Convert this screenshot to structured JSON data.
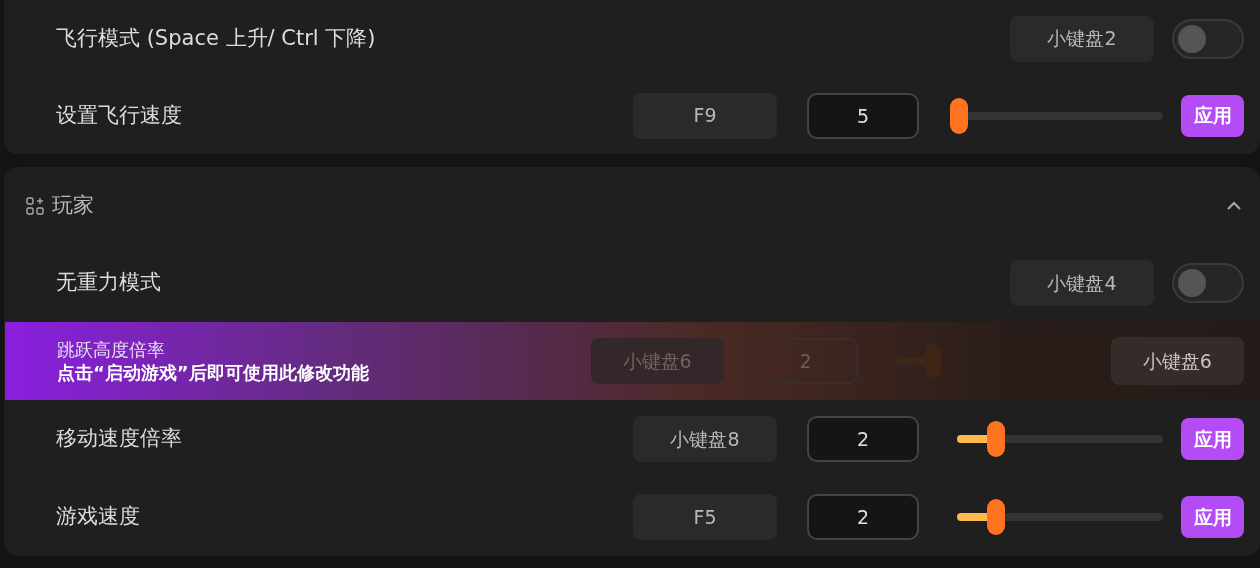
{
  "sections": [
    {
      "rows": [
        {
          "kind": "toggle",
          "label": "飞行模式 (Space 上升/ Ctrl 下降)",
          "hotkey": "小键盘2",
          "on": false
        },
        {
          "kind": "slider",
          "label": "设置飞行速度",
          "hotkey": "F9",
          "value": "5",
          "level": 0,
          "button": "应用"
        }
      ]
    },
    {
      "title": "玩家",
      "expanded": true,
      "rows": [
        {
          "kind": "toggle",
          "label": "无重力模式",
          "hotkey": "小键盘4",
          "on": false
        },
        {
          "kind": "locked",
          "label": "跳跃高度倍率",
          "message": "点击“启动游戏”后即可使用此修改功能",
          "hotkey": "小键盘6",
          "value": "2",
          "hotkey_badge": "小键盘6"
        },
        {
          "kind": "slider",
          "label": "移动速度倍率",
          "hotkey": "小键盘8",
          "value": "2",
          "level": 0.19,
          "button": "应用"
        },
        {
          "kind": "slider",
          "label": "游戏速度",
          "hotkey": "F5",
          "value": "2",
          "level": 0.19,
          "button": "应用"
        }
      ]
    }
  ]
}
